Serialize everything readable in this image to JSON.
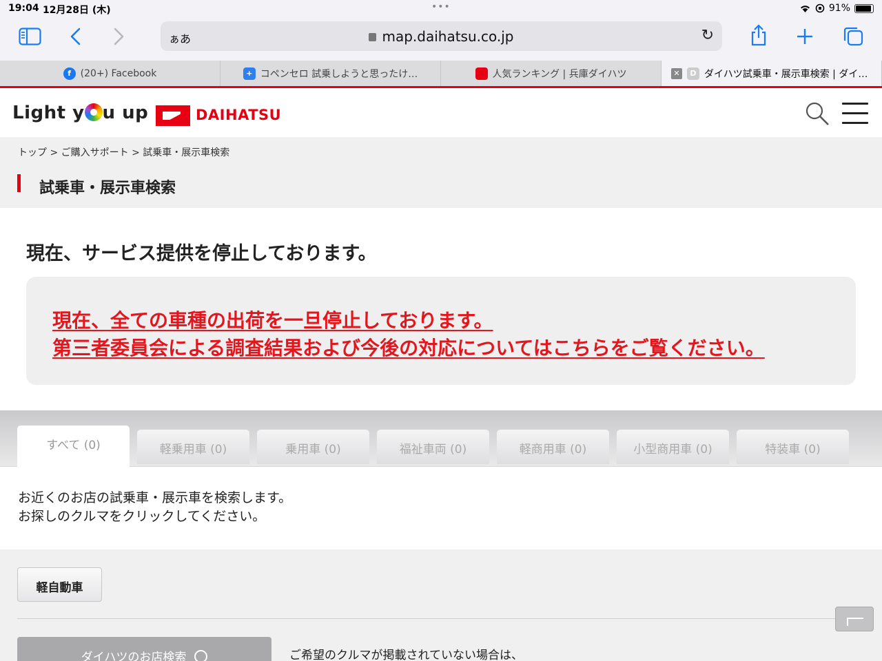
{
  "status": {
    "time": "19:04",
    "date": "12月28日 (木)",
    "battery": "91%"
  },
  "browser": {
    "text_size_label": "ぁあ",
    "url": "map.daihatsu.co.jp",
    "tabs": [
      {
        "label": "(20+) Facebook",
        "favicon": "facebook-icon"
      },
      {
        "label": "コペンセロ 試乗しようと思ったけ…",
        "favicon": "copen-icon"
      },
      {
        "label": "人気ランキング | 兵庫ダイハツ",
        "favicon": "daihatsu-icon"
      },
      {
        "label": "ダイハツ試乗車・展示車検索 | ダイ…",
        "favicon_letter": "D",
        "active": true
      }
    ]
  },
  "site": {
    "logo_text_a": "Light y",
    "logo_text_b": "u up",
    "brand": "DAIHATSU",
    "breadcrumb": "トップ > ご購入サポート > 試乗車・展示車検索",
    "page_title": "試乗車・展示車検索"
  },
  "notice": {
    "heading": "現在、サービス提供を停止しております。",
    "line1": "現在、全ての車種の出荷を一旦停止しております。",
    "line2": "第三者委員会による調査結果および今後の対応についてはこちらをご覧ください。"
  },
  "categories": [
    "すべて (0)",
    "軽乗用車 (0)",
    "乗用車 (0)",
    "福祉車両 (0)",
    "軽商用車 (0)",
    "小型商用車 (0)",
    "特装車 (0)"
  ],
  "description": {
    "line1": "お近くのお店の試乗車・展示車を検索します。",
    "line2": "お探しのクルマをクリックしてください。"
  },
  "lower": {
    "kei_button": "軽自動車",
    "store_search": "ダイハツのお店検索",
    "hint": "ご希望のクルマが掲載されていない場合は、"
  },
  "colors": {
    "brand_red": "#e60012",
    "notice_red": "#e3161e",
    "ios_blue": "#1a7cf5"
  }
}
